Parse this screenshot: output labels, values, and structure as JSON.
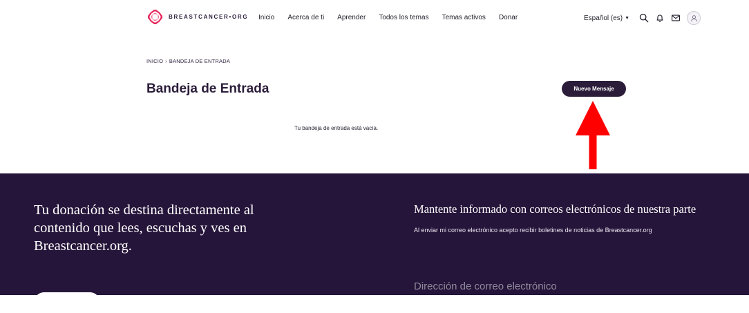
{
  "header": {
    "logo_text": "BREASTCANCER•ORG",
    "nav": [
      {
        "label": "Inicio"
      },
      {
        "label": "Acerca de ti"
      },
      {
        "label": "Aprender"
      },
      {
        "label": "Todos los temas"
      },
      {
        "label": "Temas activos"
      },
      {
        "label": "Donar"
      }
    ],
    "language": "Español (es)",
    "icons": [
      "search-icon",
      "bell-icon",
      "mail-icon",
      "user-icon"
    ]
  },
  "breadcrumb": {
    "items": [
      "INICIO",
      "BANDEJA DE ENTRADA"
    ],
    "separator": "›"
  },
  "main": {
    "title": "Bandeja de Entrada",
    "new_message_label": "Nuevo Mensaje",
    "empty_text": "Tu bandeja de entrada está vacía."
  },
  "footer": {
    "donate_text": "Tu donación se destina directamente al contenido que lees, escuchas y ves en Breastcancer.org.",
    "newsletter_title": "Mantente informado con correos electrónicos de nuestra parte",
    "newsletter_consent": "Al enviar mi correo electrónico acepto recibir boletines de noticias de Breastcancer.org",
    "email_placeholder": "Dirección de correo electrónico"
  },
  "colors": {
    "brand_dark": "#2b1d3a",
    "footer_bg": "#26153a",
    "logo_accent": "#e6245a",
    "annotation": "#ff0000"
  }
}
